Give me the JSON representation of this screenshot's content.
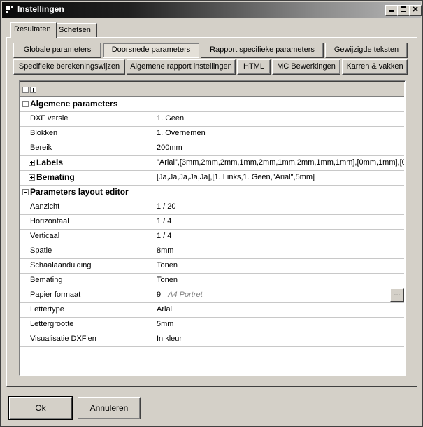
{
  "window": {
    "title": "Instellingen"
  },
  "tabs": [
    {
      "label": "Resultaten"
    },
    {
      "label": "Schetsen"
    }
  ],
  "buttons_row1": [
    {
      "label": "Globale parameters"
    },
    {
      "label": "Doorsnede parameters"
    },
    {
      "label": "Rapport specifieke parameters"
    },
    {
      "label": "Gewijzigde teksten"
    }
  ],
  "buttons_row2": [
    {
      "label": "Specifieke berekeningswijzen"
    },
    {
      "label": "Algemene rapport instellingen"
    },
    {
      "label": "HTML"
    },
    {
      "label": "MC Bewerkingen"
    },
    {
      "label": "Karren & vakken"
    }
  ],
  "grid": {
    "rows": [
      {
        "name": "Algemene parameters",
        "value": ""
      },
      {
        "name": "DXF versie",
        "value": "1. Geen"
      },
      {
        "name": "Blokken",
        "value": "1. Overnemen"
      },
      {
        "name": "Bereik",
        "value": "200mm"
      },
      {
        "name": "Labels",
        "value": "\"Arial\",[3mm,2mm,2mm,1mm,2mm,1mm,2mm,1mm,1mm],[0mm,1mm],[0mm,0"
      },
      {
        "name": "Bemating",
        "value": "[Ja,Ja,Ja,Ja,Ja],[1. Links,1. Geen,\"Arial\",5mm]"
      },
      {
        "name": "Parameters layout editor",
        "value": ""
      },
      {
        "name": "Aanzicht",
        "value": "1 / 20"
      },
      {
        "name": "Horizontaal",
        "value": "1 / 4"
      },
      {
        "name": "Verticaal",
        "value": "1 / 4"
      },
      {
        "name": "Spatie",
        "value": "8mm"
      },
      {
        "name": "Schaalaanduiding",
        "value": "Tonen"
      },
      {
        "name": "Bemating",
        "value": "Tonen"
      },
      {
        "name": "Papier formaat",
        "value": "9",
        "hint": "A4 Portret",
        "dots": "..."
      },
      {
        "name": "Lettertype",
        "value": "Arial"
      },
      {
        "name": "Lettergrootte",
        "value": "5mm"
      },
      {
        "name": "Visualisatie DXF'en",
        "value": "In kleur"
      }
    ]
  },
  "footer": {
    "ok_label": "Ok",
    "cancel_label": "Annuleren"
  }
}
